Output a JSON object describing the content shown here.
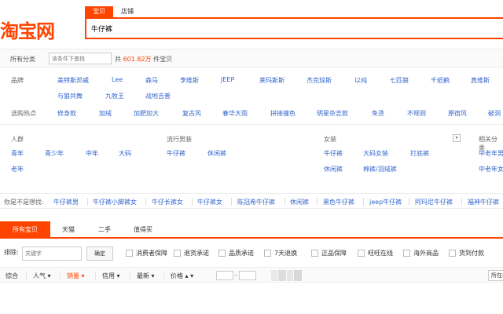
{
  "brand": {
    "logo_text": "淘宝网"
  },
  "search": {
    "tabs": [
      {
        "label": "宝贝"
      },
      {
        "label": "店铺"
      }
    ],
    "query": "牛仔裤"
  },
  "crumb": {
    "all_label": "所有分类",
    "search_in_placeholder": "该条件下查找",
    "count_prefix": "共",
    "count_value": "601.82万",
    "count_suffix": "件宝贝"
  },
  "attrs": {
    "brand_label": "品牌",
    "brands": [
      "美特斯邦威",
      "Lee",
      "森马",
      "李维斯",
      "JEEP",
      "莱玛斯斯",
      "杰克琼斯",
      "以纯",
      "七匹狼",
      "千纸鹤",
      "真维斯"
    ],
    "brands2": [
      "与狼共舞",
      "九牧王",
      "战地吉普"
    ],
    "hot_label": "选购热点",
    "hots": [
      "修身款",
      "加绒",
      "加肥加大",
      "复古风",
      "春华大雨",
      "拼接撞色",
      "明星杂志款",
      "免烫",
      "不规则",
      "原宿风",
      "破洞"
    ]
  },
  "cats": {
    "crowd_title": "人群",
    "crowd": [
      "青年",
      "青少年",
      "中年",
      "大码",
      "老年"
    ],
    "men_title": "流行男装",
    "men": [
      "牛仔裤",
      "休闲裤"
    ],
    "women_title": "女装",
    "women": [
      "牛仔裤",
      "大码女装",
      "打底裤",
      "休闲裤",
      "棉裤/羽绒裤"
    ],
    "rel_title": "相关分类",
    "rel": [
      "中老年男装",
      "中老年女装"
    ]
  },
  "related": {
    "label": "你是不是想找:",
    "items": [
      "牛仔裤男",
      "牛仔裤小脚裤女",
      "牛仔长裤女",
      "牛仔裤女",
      "陈冠希牛仔裤",
      "休闲裤",
      "黑色牛仔裤",
      "jeep牛仔裤",
      "阿玛尼牛仔裤",
      "福神牛仔裤"
    ]
  },
  "tabs": [
    "所有宝贝",
    "天猫",
    "二手",
    "值得买"
  ],
  "filters": {
    "exclude_label": "排除:",
    "exclude_placeholder": "关键字",
    "confirm_label": "确定",
    "checks": [
      "消费者保障",
      "退货承诺",
      "品质承诺",
      "7天退换",
      "正品保障",
      "旺旺在线",
      "海外商品",
      "货到付款"
    ]
  },
  "sort": {
    "items": [
      "综合",
      "人气 ▾",
      "销量 ▾",
      "信用 ▾",
      "最新 ▾",
      "价格 ▴ ▾"
    ],
    "price_dash": "-",
    "all_select": "所在地"
  },
  "colors": {
    "accent": "#ff4400",
    "link": "#3366cc"
  }
}
